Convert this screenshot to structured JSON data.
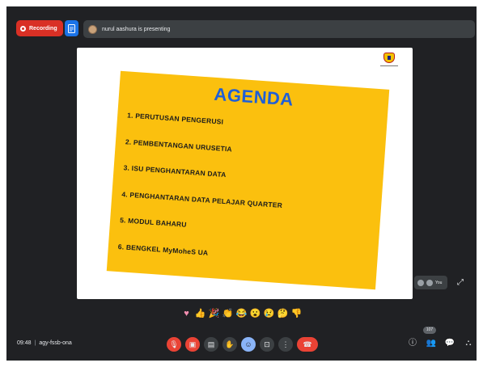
{
  "top_bar": {
    "recording_label": "Recording",
    "presenting_text": "nurul aashura is presenting"
  },
  "slide": {
    "title": "AGENDA",
    "items": [
      "1. PERUTUSAN PENGERUSI",
      "2. PEMBENTANGAN URUSETIA",
      "3. ISU PENGHANTARAN DATA",
      "4. PENGHANTARAN DATA PELAJAR QUARTER",
      "5. MODUL BAHARU",
      "6. BENGKEL MyMoheS UA"
    ]
  },
  "side_controls": {
    "you_label": "You"
  },
  "reactions": [
    "sparkling-heart",
    "thumbs-up",
    "party-popper",
    "clapping-hands",
    "tears-of-joy",
    "surprised-face",
    "crying-face",
    "thinking-face",
    "thumbs-down"
  ],
  "bottom_bar": {
    "time": "09:48",
    "separator": "|",
    "meeting_code": "agy-fssb-ona",
    "participant_count": "107"
  },
  "colors": {
    "background": "#202124",
    "recording": "#d93025",
    "slide_card": "#fbc00e",
    "agenda_title": "#1f5fd6",
    "end_call": "#ea4335"
  }
}
